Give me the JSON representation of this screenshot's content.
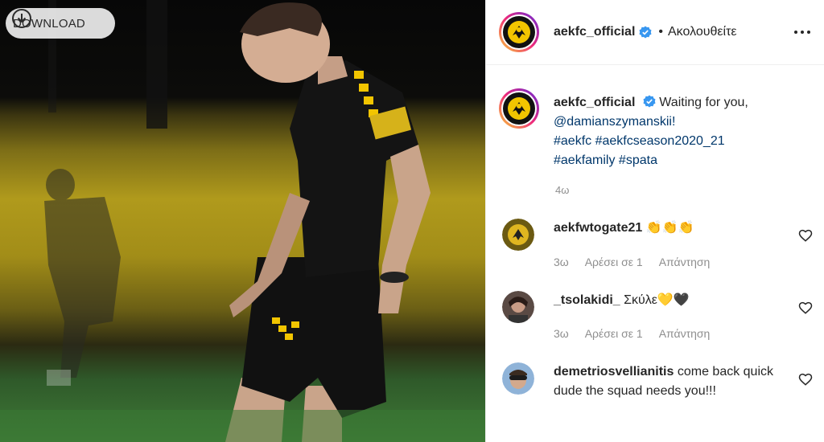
{
  "download": {
    "label": "DOWNLOAD",
    "icon": "download-circle-icon"
  },
  "header": {
    "username": "aekfc_official",
    "dot": "•",
    "follow_label": "Ακολουθείτε",
    "more_icon": "more-dots-icon"
  },
  "caption": {
    "username": "aekfc_official",
    "text": "Waiting for you,",
    "mention": "@damianszymanskii!",
    "hashtags_line1": "#aekfc #aekfcseason2020_21",
    "hashtags_line2": "#aekfamily #spata",
    "time": "4ω"
  },
  "comments": [
    {
      "username": "aekfwtogate21",
      "text": "👏👏👏",
      "time": "3ω",
      "likes": "Αρέσει σε 1",
      "reply": "Απάντηση"
    },
    {
      "username": "_tsolakidi_",
      "text": "Σκύλε💛🖤",
      "time": "3ω",
      "likes": "Αρέσει σε 1",
      "reply": "Απάντηση"
    },
    {
      "username": "demetriosvellianitis",
      "text": "come back quick dude the squad needs you!!!",
      "time": "",
      "likes": "",
      "reply": ""
    }
  ],
  "colors": {
    "verified": "#3897f0",
    "brand_yellow": "#f2c500",
    "text": "#262626",
    "muted": "#8e8e8e"
  }
}
